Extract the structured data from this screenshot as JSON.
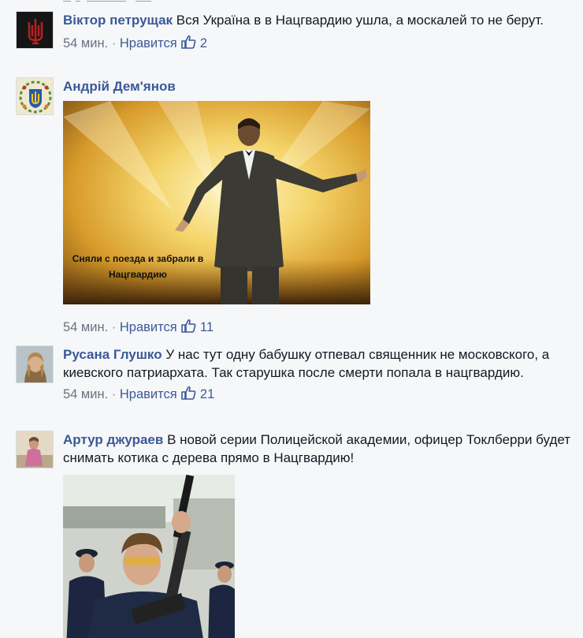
{
  "comments": [
    {
      "author": "Віктор петрущак",
      "text": "Вся Україна в в Нацгвардию ушла, а москалей то не берут.",
      "time": "54 мин.",
      "like_label": "Нравится",
      "likes": "2"
    },
    {
      "author": "Андрій Дем'янов",
      "text": "",
      "image_caption": "Сняли с поезда и забрали в Нацгвардию",
      "time": "54 мин.",
      "like_label": "Нравится",
      "likes": "11"
    },
    {
      "author": "Русана Глушко",
      "text": "У нас тут одну бабушку отпевал священник не московского, а киевского патриархата. Так старушка после смерти попала в нацгвардию.",
      "time": "54 мин.",
      "like_label": "Нравится",
      "likes": "21"
    },
    {
      "author": "Артур джураев",
      "text": "В новой серии Полицейской академии, офицер Токлберри будет снимать котика с дерева прямо в Нацгвардию!",
      "time": "",
      "like_label": "",
      "likes": ""
    }
  ],
  "separator": "·",
  "colors": {
    "link": "#3b5998",
    "meta": "#6b7280",
    "background": "#f6f7f9"
  },
  "icons": [
    "like-thumb-icon"
  ]
}
